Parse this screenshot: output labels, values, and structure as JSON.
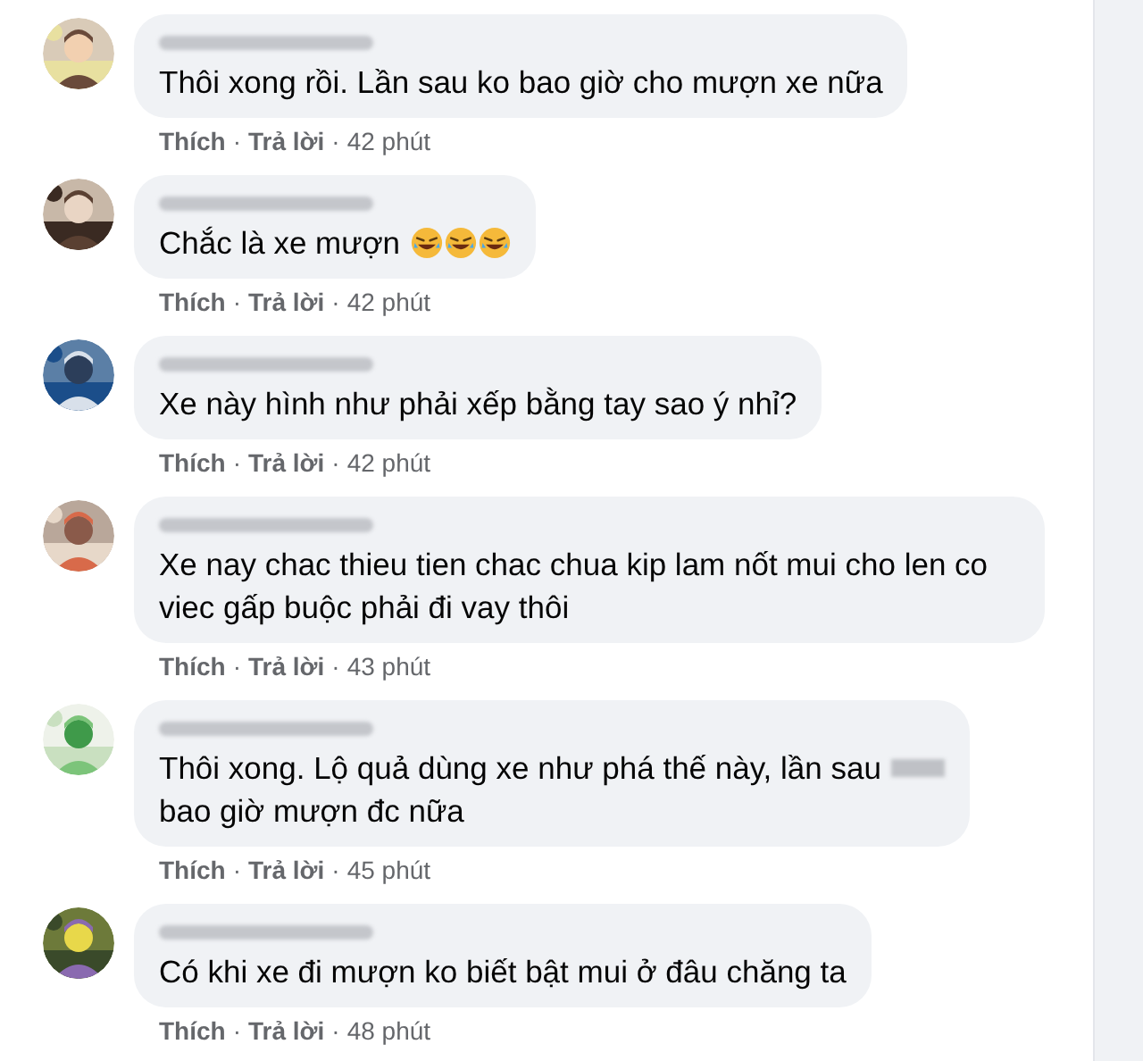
{
  "separator": "·",
  "comments": [
    {
      "name_blurred": true,
      "text": "Thôi xong rồi. Lần sau ko bao giờ cho mượn xe nữa",
      "like": "Thích",
      "reply": "Trả lời",
      "time": "42 phút"
    },
    {
      "name_blurred": true,
      "text": "Chắc là xe mượn",
      "emojis": [
        {
          "kind": "rolling-laughing"
        },
        {
          "kind": "rolling-laughing"
        },
        {
          "kind": "rolling-laughing"
        }
      ],
      "like": "Thích",
      "reply": "Trả lời",
      "time": "42 phút"
    },
    {
      "name_blurred": true,
      "text": "Xe này hình như phải xếp bằng tay sao ý nhỉ?",
      "like": "Thích",
      "reply": "Trả lời",
      "time": "42 phút"
    },
    {
      "name_blurred": true,
      "text": "Xe nay chac thieu tien chac chua kip lam nốt mui cho len co viec gấp buộc phải đi vay thôi",
      "like": "Thích",
      "reply": "Trả lời",
      "time": "43 phút"
    },
    {
      "name_blurred": true,
      "text": "Thôi xong. Lộ quả dùng xe như phá thế này, lần sau",
      "blurred_word": true,
      "text_after": "bao giờ mượn đc nữa",
      "like": "Thích",
      "reply": "Trả lời",
      "time": "45 phút"
    },
    {
      "name_blurred": true,
      "text": "Có khi xe đi mượn ko biết bật mui ở đâu chăng ta",
      "like": "Thích",
      "reply": "Trả lời",
      "time": "48 phút"
    }
  ]
}
